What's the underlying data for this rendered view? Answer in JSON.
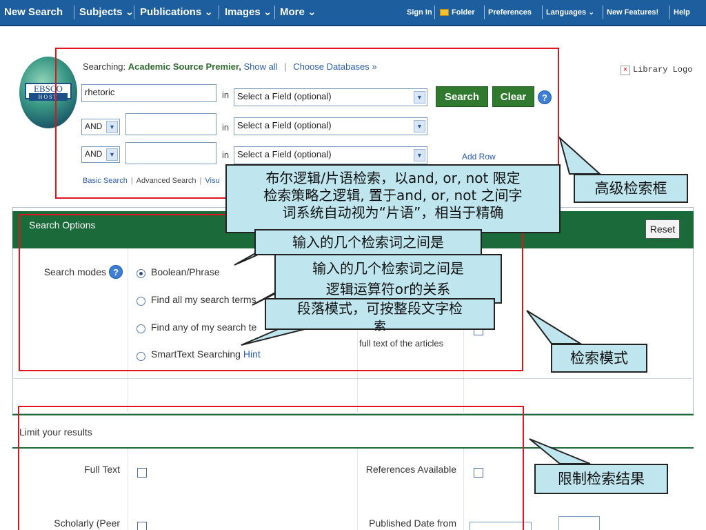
{
  "nav": {
    "new_search": "New Search",
    "subjects": "Subjects",
    "publications": "Publications",
    "images": "Images",
    "more": "More",
    "chevron": "⌄",
    "sign_in": "Sign In",
    "folder": "Folder",
    "preferences": "Preferences",
    "languages": "Languages",
    "new_features": "New Features!",
    "help": "Help"
  },
  "header": {
    "logo_text": "EBSCO",
    "logo_sub": "HOST",
    "searching_prefix": "Searching:",
    "database": "Academic Source Premier,",
    "show_all": "Show all",
    "choose_databases": "Choose Databases »",
    "library_logo": "Library Logo"
  },
  "search": {
    "row1_term": "rhetoric",
    "in_label": "in",
    "field_placeholder": "Select a Field (optional)",
    "bool_op": "AND",
    "search_button": "Search",
    "clear_button": "Clear",
    "help": "?",
    "add_row": "Add Row",
    "basic_search": "Basic Search",
    "advanced_search": "Advanced Search",
    "visual_search_partial": "Visu"
  },
  "options": {
    "title": "Search Options",
    "reset": "Reset",
    "search_modes_label": "Search modes",
    "modes": [
      "Boolean/Phrase",
      "Find all my search terms",
      "Find any of my search te",
      "SmartText Searching"
    ],
    "hint": "Hint",
    "fulltext_articles": "full text of the articles"
  },
  "limits": {
    "title": "Limit your results",
    "full_text": "Full Text",
    "references_available": "References Available",
    "scholarly": "Scholarly (Peer",
    "published_date": "Published Date from"
  },
  "annotations": {
    "advanced_box": "高级检索框",
    "search_mode": "检索模式",
    "limit_results": "限制检索结果",
    "boolean_line1": "布尔逻辑/片语检索，以and, or, not 限定",
    "boolean_line2": "检索策略之逻辑, 置于and, or, not 之间字",
    "boolean_line3": "词系统自动视为“片语”，相当于精确",
    "all_terms": "输入的几个检索词之间是",
    "any_terms_line1": "输入的几个检索词之间是",
    "any_terms_line2": "逻辑运算符or的关系",
    "smarttext_line1": "段落模式，可按整段文字检",
    "smarttext_line2": "索"
  },
  "colors": {
    "nav_blue": "#1c5e9e",
    "green": "#1b6a3a",
    "button_green": "#2f7a2f",
    "annotation_red": "#e0141e",
    "callout_fill": "#bfe6ef"
  }
}
